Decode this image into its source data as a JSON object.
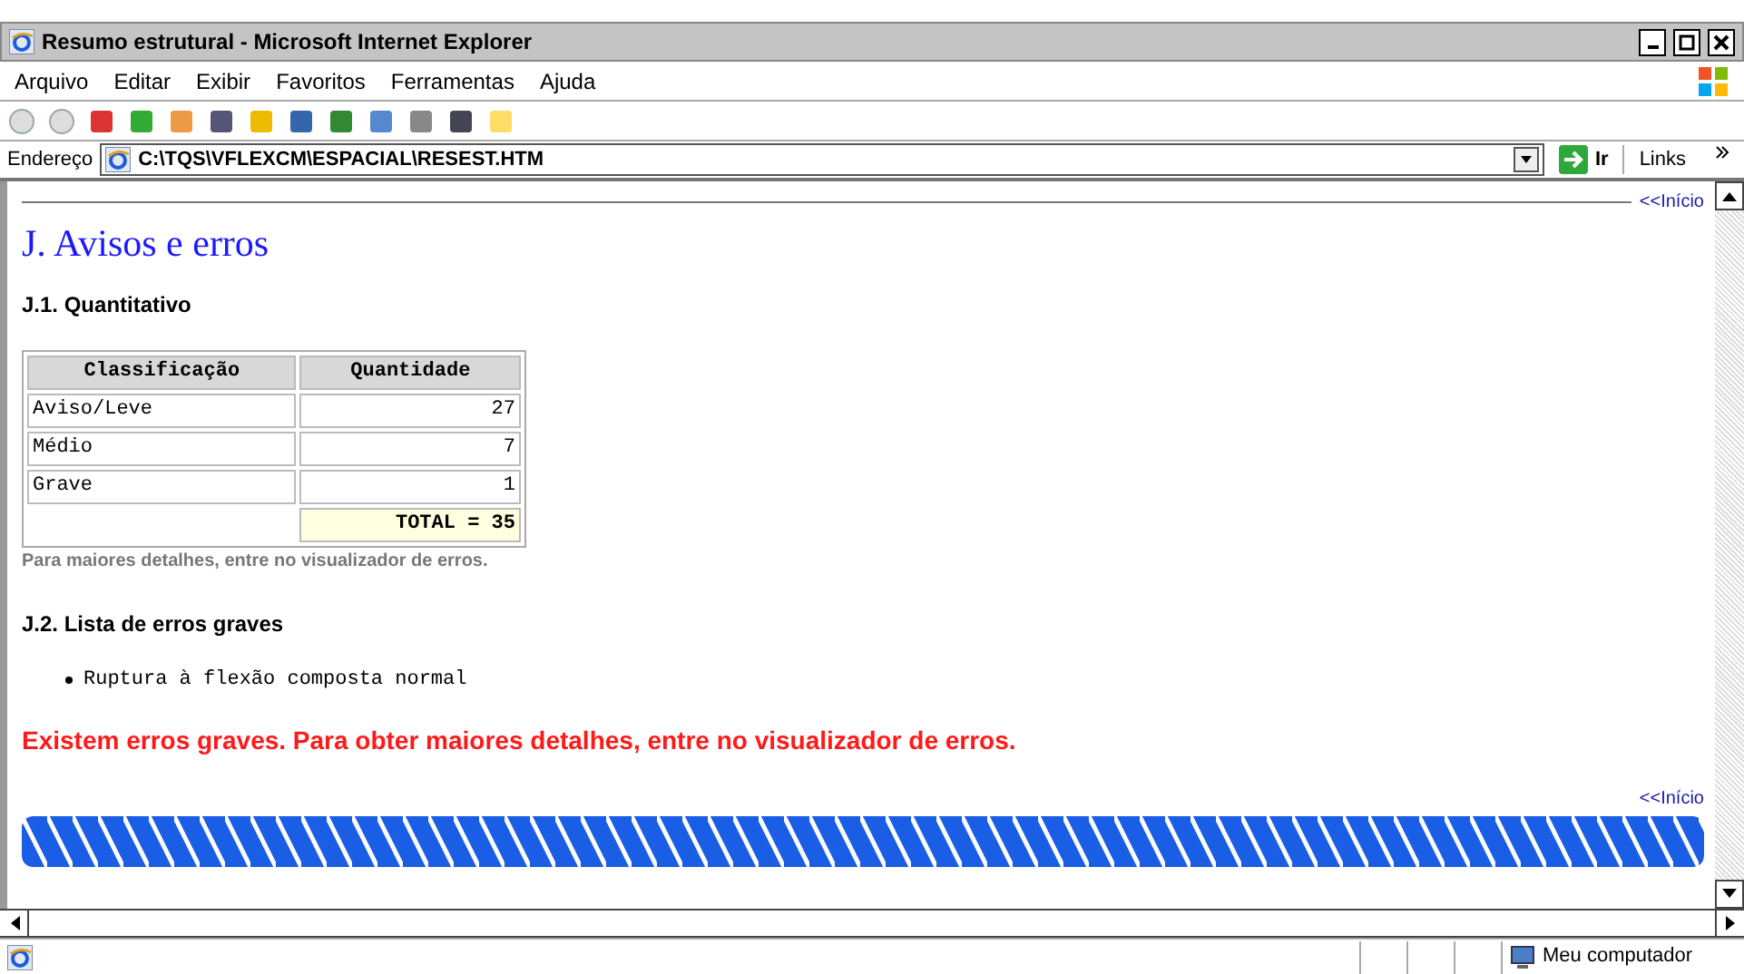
{
  "window": {
    "title": "Resumo estrutural - Microsoft Internet Explorer"
  },
  "menu": [
    "Arquivo",
    "Editar",
    "Exibir",
    "Favoritos",
    "Ferramentas",
    "Ajuda"
  ],
  "address": {
    "label": "Endereço",
    "value": "C:\\TQS\\VFLEXCM\\ESPACIAL\\RESEST.HTM",
    "go": "Ir",
    "links": "Links"
  },
  "page": {
    "top_link": "<<Início",
    "heading": "J. Avisos e erros",
    "section_1": "J.1. Quantitativo",
    "table": {
      "columns": [
        "Classificação",
        "Quantidade"
      ],
      "rows": [
        [
          "Aviso/Leve",
          "27"
        ],
        [
          "Médio",
          "7"
        ],
        [
          "Grave",
          "1"
        ]
      ],
      "total": "TOTAL = 35"
    },
    "note": "Para maiores detalhes, entre no visualizador de erros.",
    "section_2": "J.2. Lista de erros graves",
    "errors": [
      "Ruptura à flexão composta normal"
    ],
    "warning": "Existem erros graves. Para obter maiores detalhes, entre no visualizador de erros.",
    "bottom_link": "<<Início"
  },
  "status_bar": {
    "zone": "Meu computador"
  }
}
